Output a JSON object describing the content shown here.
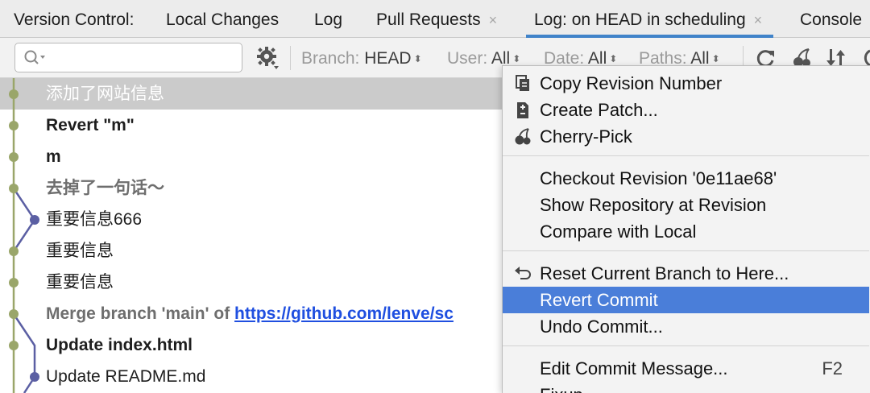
{
  "tabs": {
    "title": "Version Control:",
    "items": [
      {
        "label": "Local Changes"
      },
      {
        "label": "Log"
      },
      {
        "label": "Pull Requests",
        "closable": true
      },
      {
        "label": "Log: on HEAD in scheduling",
        "closable": true,
        "active": true
      },
      {
        "label": "Console"
      }
    ],
    "close_glyph": "×"
  },
  "toolbar": {
    "search_placeholder": "",
    "branch_label": "Branch:",
    "branch_value": "HEAD",
    "user_label": "User:",
    "user_value": "All",
    "date_label": "Date:",
    "date_value": "All",
    "paths_label": "Paths:",
    "paths_value": "All",
    "dropdown_glyph": "⬍"
  },
  "commits": [
    {
      "message": "添加了网站信息",
      "style": "white",
      "selected": true
    },
    {
      "message": "Revert \"m\"",
      "style": "bold"
    },
    {
      "message": "m",
      "style": "bold"
    },
    {
      "message": "去掉了一句话～",
      "style": "gray"
    },
    {
      "message": "重要信息666",
      "style": "normal"
    },
    {
      "message": "重要信息",
      "style": "normal"
    },
    {
      "message": "重要信息",
      "style": "normal"
    },
    {
      "message_prefix": "Merge branch 'main' of ",
      "link": "https://github.com/lenve/sc",
      "style": "gray"
    },
    {
      "message": "Update index.html",
      "style": "bold"
    },
    {
      "message": "Update README.md",
      "style": "normal"
    }
  ],
  "graph_colors": {
    "main": "#9aa66a",
    "branch": "#5b5fa3"
  },
  "context_menu": {
    "items": [
      {
        "label": "Copy Revision Number",
        "icon": "copy-icon"
      },
      {
        "label": "Create Patch...",
        "icon": "patch-icon"
      },
      {
        "label": "Cherry-Pick",
        "icon": "cherry-icon"
      },
      {
        "label": "Checkout Revision '0e11ae68'"
      },
      {
        "label": "Show Repository at Revision"
      },
      {
        "label": "Compare with Local"
      },
      {
        "label": "Reset Current Branch to Here...",
        "icon": "undo-arrow-icon"
      },
      {
        "label": "Revert Commit",
        "highlighted": true
      },
      {
        "label": "Undo Commit..."
      },
      {
        "label": "Edit Commit Message...",
        "shortcut": "F2"
      },
      {
        "label": "Fixup..."
      }
    ],
    "highlight_color": "#4a7ed9"
  }
}
